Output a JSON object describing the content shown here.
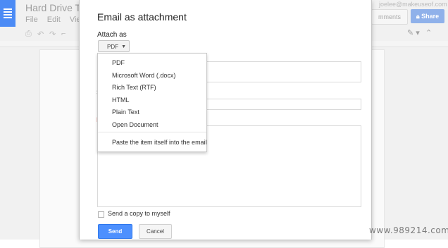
{
  "background": {
    "doc_title": "Hard Drive Th",
    "menu": [
      "File",
      "Edit",
      "View"
    ],
    "user_email": "joelee@makeuseof.com",
    "comments_label": "mments",
    "share_label": "Share"
  },
  "dialog": {
    "title": "Email as attachment",
    "attach_label": "Attach as",
    "selected_format": "PDF",
    "copy_label": "Send a copy to myself",
    "send_label": "Send",
    "cancel_label": "Cancel",
    "fragment_s": "S",
    "fragment_m": "M"
  },
  "dropdown": {
    "options": [
      "PDF",
      "Microsoft Word (.docx)",
      "Rich Text (RTF)",
      "HTML",
      "Plain Text",
      "Open Document",
      "Paste the item itself into the email"
    ]
  },
  "watermark": "www.989214.com",
  "colors": {
    "accent": "#4d90fe",
    "share": "#8fb1ea",
    "logo": "#4c8bf5"
  }
}
